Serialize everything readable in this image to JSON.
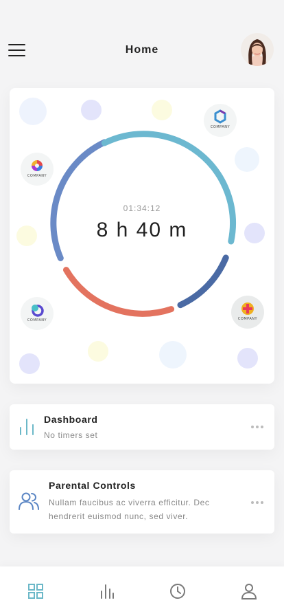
{
  "header": {
    "title": "Home",
    "menu_icon": "hamburger-menu-icon",
    "avatar": "user-avatar"
  },
  "timer": {
    "elapsed": "01:34:12",
    "total": "8 h 40 m",
    "ring_colors": [
      "#6a8ac6",
      "#6cb8d0",
      "#4a6aa4",
      "#e3735f"
    ]
  },
  "app_logos": [
    {
      "name": "company-logo-top-right",
      "text": "COMPANY"
    },
    {
      "name": "company-logo-left",
      "text": "COMPANY"
    },
    {
      "name": "company-logo-bottom-left",
      "text": "COMPANY"
    },
    {
      "name": "company-logo-bottom-right",
      "text": "COMPANY"
    }
  ],
  "cards": {
    "dashboard": {
      "title": "Dashboard",
      "subtitle": "No timers set",
      "icon": "bar-chart-icon"
    },
    "parental": {
      "title": "Parental Controls",
      "description_line1": "Nullam faucibus  ac viverra efficitur. Dec",
      "description_line2": "hendrerit euismod nunc, sed viver.",
      "icon": "users-icon"
    }
  },
  "bottom_nav": {
    "items": [
      "grid-icon",
      "stats-icon",
      "clock-icon",
      "profile-icon"
    ],
    "active_color": "#6cb8c8",
    "inactive_color": "#7a7a7a"
  }
}
